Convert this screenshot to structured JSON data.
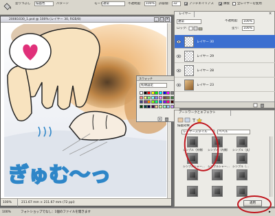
{
  "options_bar": {
    "row1_left": "塗りつぶし",
    "source": "描画色",
    "pattern": "パターン",
    "mode_label": "モード:",
    "mode_value": "通常",
    "opacity_label": "不透明度:",
    "opacity_value": "100%",
    "tolerance_label": "許容値:",
    "tolerance_value": "32",
    "antialias_label": "アンチエイリアス",
    "contiguous_label": "隣接",
    "all_layers_label": "全レイヤーを使用"
  },
  "document": {
    "title": "20081030_1.psd @ 100% (レイヤー 30, RGB/8)",
    "zoom": "100%",
    "doc_size": "211.67 mm × 211.67 mm (72 ppi)",
    "caption": "ぎゅむ～っ"
  },
  "status_bar": {
    "left": "100%",
    "message": "フォトショップでなし：1個のファイルを開きます",
    "right_glyph": "▶"
  },
  "layers_panel": {
    "tab": "レイヤー",
    "blend_mode": "通常",
    "opacity_label": "不透明度:",
    "opacity_value": "100%",
    "lock_label": "ロック:",
    "fill_label": "塗り:",
    "fill_value": "100%",
    "layers": [
      {
        "name": "レイヤー 30",
        "selected": true
      },
      {
        "name": "レイヤー 29",
        "selected": false
      },
      {
        "name": "レイヤー 28",
        "selected": false
      },
      {
        "name": "レイヤー 23",
        "selected": false
      }
    ]
  },
  "effects_panel": {
    "tab": "アートワークとエフェクト",
    "category": "描画効果",
    "style_dropdown": "レイヤースタイル",
    "bevel_dropdown": "ベベル",
    "tiles": [
      "シンプル（外側）",
      "シンプル（内側）",
      "シンプル（丸）",
      "シンプルシャー…",
      "シンプルシャー…",
      "シンプル（…",
      "",
      "",
      "",
      "",
      "",
      ""
    ],
    "apply_label": "適用"
  },
  "swatches_panel": {
    "tab": "スウォッチ",
    "dropdown": "初期設定",
    "colors": [
      "#ffffff",
      "#000000",
      "#ff0000",
      "#ffff00",
      "#00ff00",
      "#00ffff",
      "#0000ff",
      "#ff00ff",
      "#808080",
      "#c0c0c0",
      "#ff8080",
      "#ffff80",
      "#80ff80",
      "#80ffff",
      "#8080ff",
      "#ff80ff",
      "#804040",
      "#808040",
      "#408040",
      "#408080",
      "#404080",
      "#804080",
      "#ff8000",
      "#80ff00",
      "#00ff80",
      "#0080ff",
      "#8000ff",
      "#ff0080",
      "#400000",
      "#404000",
      "#004000",
      "#004040",
      "#000040",
      "#400040",
      "#ffcc99",
      "#ccff99",
      "#99ffcc",
      "#99ccff",
      "#cc99ff",
      "#ff99cc"
    ]
  },
  "colors": {
    "accent_red": "#c0151d",
    "caption_blue": "#2e86c8",
    "selection_blue": "#3c6fd0"
  }
}
